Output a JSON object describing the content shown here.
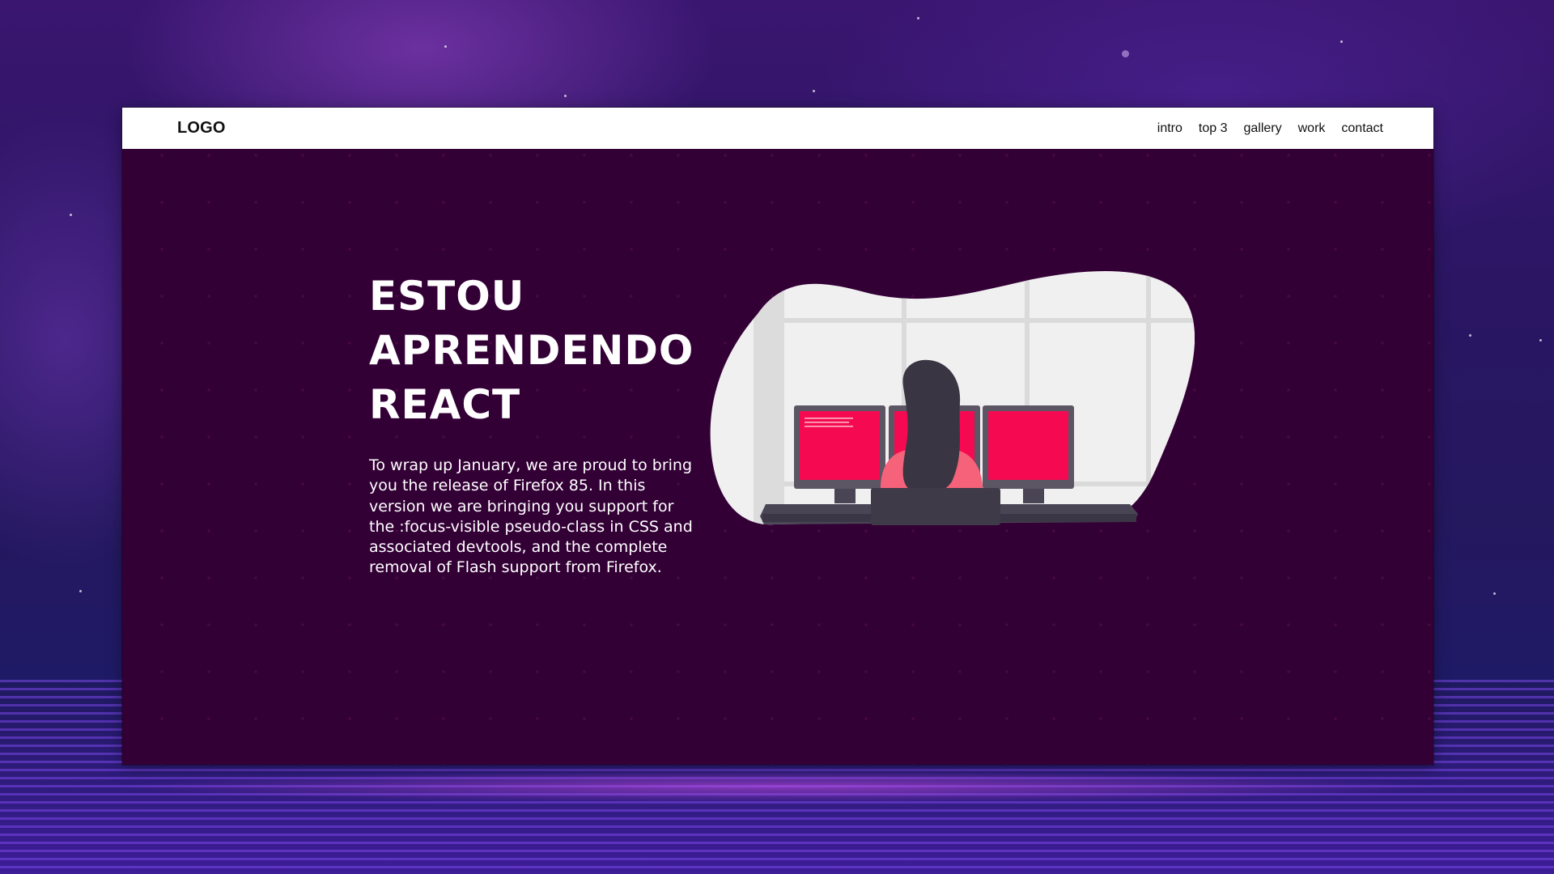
{
  "navbar": {
    "logo": "LOGO",
    "links": [
      "intro",
      "top 3",
      "gallery",
      "work",
      "contact"
    ]
  },
  "hero": {
    "title_lines": [
      "ESTOU",
      "APRENDENDO",
      "REACT"
    ],
    "paragraph": "To wrap up January, we are proud to bring you the release of Firefox 85. In this version we are bringing you support for the :focus-visible pseudo-class in CSS and associated devtools, and the complete removal of Flash support from Firefox."
  },
  "colors": {
    "page_background": "#330036",
    "navbar_background": "#ffffff",
    "accent": "#f50a52",
    "blob": "#f1f0f1"
  },
  "illustration": {
    "icon": "woman-at-monitors-illustration"
  }
}
